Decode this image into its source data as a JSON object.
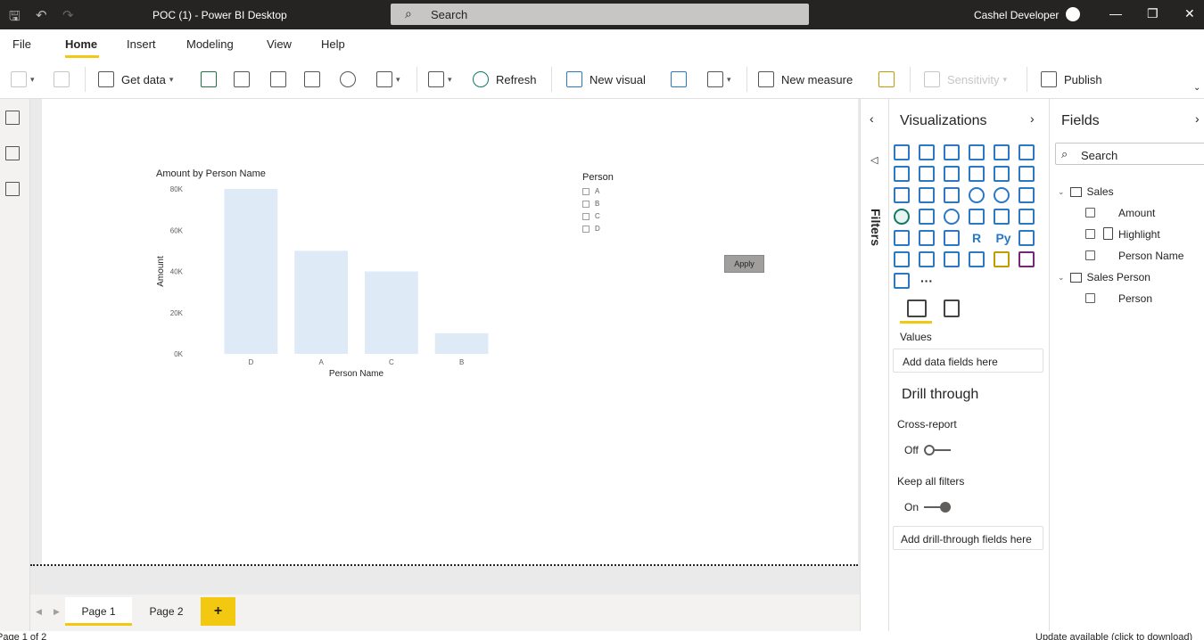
{
  "titlebar": {
    "title": "POC (1) - Power BI Desktop",
    "search_label": "Search",
    "user_name": "Cashel Developer"
  },
  "menu": {
    "items": [
      "File",
      "Home",
      "Insert",
      "Modeling",
      "View",
      "Help"
    ],
    "active": "Home"
  },
  "ribbon": {
    "get_data": "Get data",
    "refresh": "Refresh",
    "new_visual": "New visual",
    "new_measure": "New measure",
    "sensitivity": "Sensitivity",
    "publish": "Publish"
  },
  "chart": {
    "title": "Amount by Person Name",
    "xlabel": "Person Name",
    "ylabel": "Amount"
  },
  "chart_data": {
    "type": "bar",
    "title": "Amount by Person Name",
    "xlabel": "Person Name",
    "ylabel": "Amount",
    "categories": [
      "D",
      "A",
      "C",
      "B"
    ],
    "values": [
      80000,
      50000,
      40000,
      10000
    ],
    "ylim": [
      0,
      80000
    ],
    "yticks": [
      0,
      20000,
      40000,
      60000,
      80000
    ],
    "ytick_labels": [
      "0K",
      "20K",
      "40K",
      "60K",
      "80K"
    ],
    "bar_color": "#deebf7"
  },
  "slicer": {
    "title": "Person",
    "items": [
      "A",
      "B",
      "C",
      "D"
    ],
    "apply_label": "Apply"
  },
  "pages": {
    "tabs": [
      "Page 1",
      "Page 2"
    ],
    "active": "Page 1",
    "add_label": "+"
  },
  "status": {
    "page_info": "Page 1 of 2",
    "update": "Update available (click to download)"
  },
  "filters": {
    "label": "Filters"
  },
  "visualizations": {
    "title": "Visualizations",
    "values_label": "Values",
    "values_well": "Add data fields here",
    "drill_through": "Drill through",
    "cross_report": "Cross-report",
    "cross_report_state": "Off",
    "keep_all_filters": "Keep all filters",
    "keep_all_filters_state": "On",
    "drill_well": "Add drill-through fields here",
    "r_label": "R",
    "py_label": "Py",
    "more_label": "···"
  },
  "fields": {
    "title": "Fields",
    "search_placeholder": "Search",
    "tables": [
      {
        "name": "Sales",
        "fields": [
          "Amount",
          "Highlight",
          "Person Name"
        ]
      },
      {
        "name": "Sales Person",
        "fields": [
          "Person"
        ]
      }
    ]
  },
  "colors": {
    "accent": "#f2c811",
    "titlebar": "#252423",
    "bar": "#deebf7",
    "viz_icon": "#2b78c5"
  }
}
